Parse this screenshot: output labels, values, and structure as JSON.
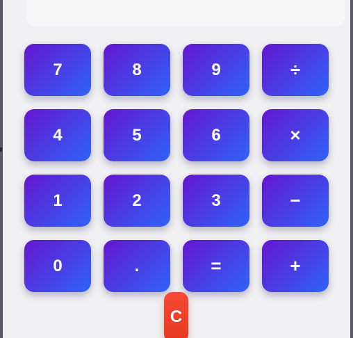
{
  "calculator": {
    "display": {
      "value": ""
    },
    "keys": [
      {
        "name": "key-7",
        "label": "7",
        "op": false
      },
      {
        "name": "key-8",
        "label": "8",
        "op": false
      },
      {
        "name": "key-9",
        "label": "9",
        "op": false
      },
      {
        "name": "key-divide",
        "label": "÷",
        "op": true
      },
      {
        "name": "key-4",
        "label": "4",
        "op": false
      },
      {
        "name": "key-5",
        "label": "5",
        "op": false
      },
      {
        "name": "key-6",
        "label": "6",
        "op": false
      },
      {
        "name": "key-multiply",
        "label": "×",
        "op": true
      },
      {
        "name": "key-1",
        "label": "1",
        "op": false
      },
      {
        "name": "key-2",
        "label": "2",
        "op": false
      },
      {
        "name": "key-3",
        "label": "3",
        "op": false
      },
      {
        "name": "key-subtract",
        "label": "−",
        "op": true
      },
      {
        "name": "key-0",
        "label": "0",
        "op": false
      },
      {
        "name": "key-decimal",
        "label": ".",
        "op": false
      },
      {
        "name": "key-equals",
        "label": "=",
        "op": true
      },
      {
        "name": "key-add",
        "label": "+",
        "op": true
      }
    ],
    "clear_label": "C"
  },
  "colors": {
    "key_gradient_start": "#6516cf",
    "key_gradient_end": "#2f63f8",
    "clear_button": "#f44a33",
    "panel_background": "#f0f0f2"
  }
}
